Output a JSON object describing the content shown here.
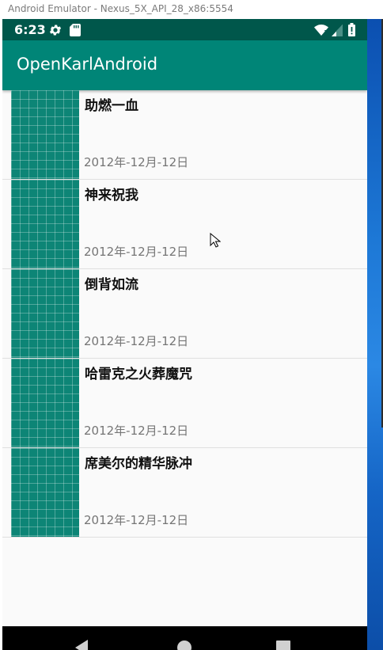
{
  "window": {
    "title": "Android Emulator - Nexus_5X_API_28_x86:5554"
  },
  "statusbar": {
    "time": "6:23",
    "icons": [
      "gear-icon",
      "sd-card-icon",
      "wifi-icon",
      "signal-icon",
      "battery-icon"
    ]
  },
  "appbar": {
    "title": "OpenKarlAndroid"
  },
  "list": {
    "items": [
      {
        "title": "助燃一血",
        "date": "2012年-12月-12日"
      },
      {
        "title": "神来祝我",
        "date": "2012年-12月-12日"
      },
      {
        "title": "倒背如流",
        "date": "2012年-12月-12日"
      },
      {
        "title": "哈雷克之火葬魔咒",
        "date": "2012年-12月-12日"
      },
      {
        "title": "席美尔的精华脉冲",
        "date": "2012年-12月-12日"
      }
    ]
  },
  "navbar": {
    "icons": [
      "back-icon",
      "home-icon",
      "recents-icon"
    ]
  },
  "colors": {
    "statusbar": "#00574b",
    "appbar": "#008577",
    "thumbnail": "#0d8576",
    "list_background": "#fafafa"
  }
}
